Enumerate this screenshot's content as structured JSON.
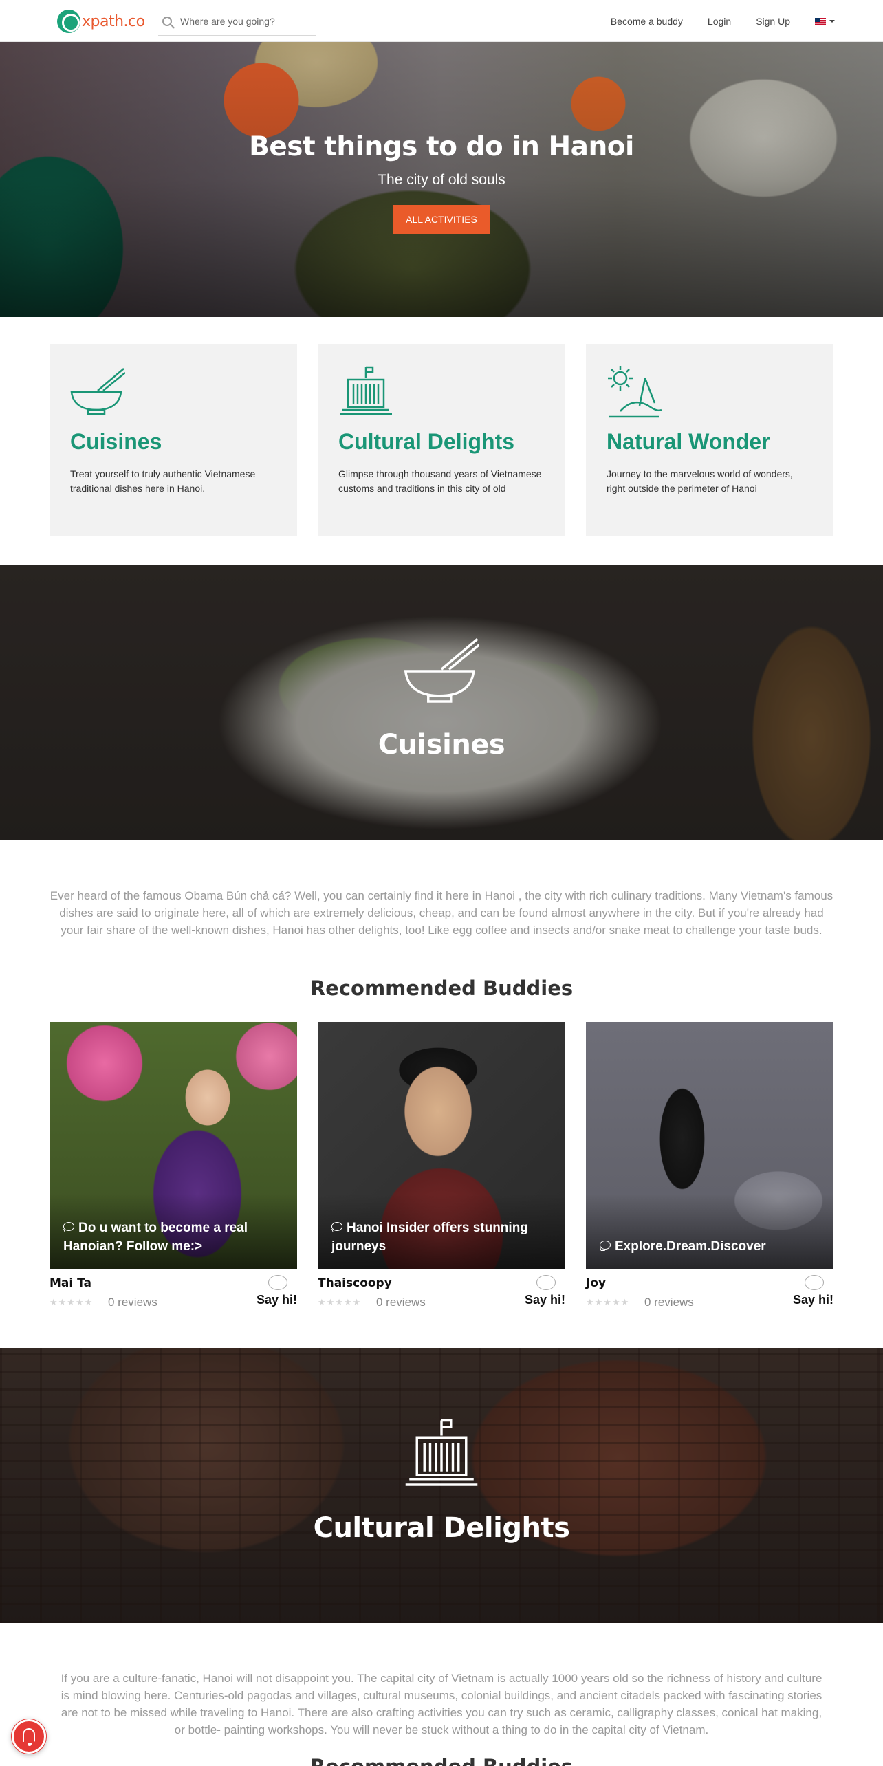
{
  "nav": {
    "logo_text": "xpath.co",
    "search_placeholder": "Where are you going?",
    "links": [
      "Become a buddy",
      "Login",
      "Sign Up"
    ],
    "language_icon": "us-flag-icon"
  },
  "hero": {
    "title": "Best things to do in Hanoi",
    "subtitle": "The city of old souls",
    "button": "ALL ACTIVITIES",
    "button_color": "#ea5b2a"
  },
  "categories": [
    {
      "icon": "bowl-chopsticks-icon",
      "title": "Cuisines",
      "description": "Treat yourself to truly authentic Vietnamese traditional dishes here in Hanoi."
    },
    {
      "icon": "temple-icon",
      "title": "Cultural Delights",
      "description": "Glimpse through thousand years of Vietnamese customs and traditions in this city of old"
    },
    {
      "icon": "sun-island-icon",
      "title": "Natural Wonder",
      "description": "Journey to the marvelous world of wonders, right outside the perimeter of Hanoi"
    }
  ],
  "accent_color": "#1a9676",
  "cuisine_section": {
    "banner_title": "Cuisines",
    "intro": "Ever heard of the famous Obama Bún chả cá? Well, you can certainly find it here in Hanoi , the city with rich culinary traditions. Many Vietnam's famous dishes are said to originate here, all of which are extremely delicious, cheap, and can be found almost anywhere in the city. But if you're already had your fair share of the well-known dishes, Hanoi has other delights, too! Like egg coffee and insects and/or snake meat to challenge your taste buds.",
    "heading": "Recommended Buddies",
    "buddies": [
      {
        "tagline": "Do u want to become a real Hanoian? Follow me:>",
        "name": "Mai Ta",
        "reviews": "0 reviews",
        "action": "Say hi!"
      },
      {
        "tagline": "Hanoi Insider offers stunning journeys",
        "name": "Thaiscoopy",
        "reviews": "0 reviews",
        "action": "Say hi!"
      },
      {
        "tagline": "Explore.Dream.Discover",
        "name": "Joy",
        "reviews": "0 reviews",
        "action": "Say hi!"
      }
    ]
  },
  "cultural_section": {
    "banner_title": "Cultural Delights",
    "intro": "If you are a culture-fanatic, Hanoi will not disappoint you. The capital city of Vietnam is actually 1000 years old so the richness of history and culture is mind blowing here. Centuries-old pagodas and villages, cultural museums, colonial buildings, and ancient citadels packed with fascinating stories are not to be missed while traveling to Hanoi. There are also crafting activities you can try such as ceramic, calligraphy classes, conical hat making, or bottle- painting workshops. You will never be stuck without a thing to do in the capital city of Vietnam.",
    "heading": "Recommended Buddies"
  },
  "rating": {
    "stars": 0,
    "max": 5
  }
}
